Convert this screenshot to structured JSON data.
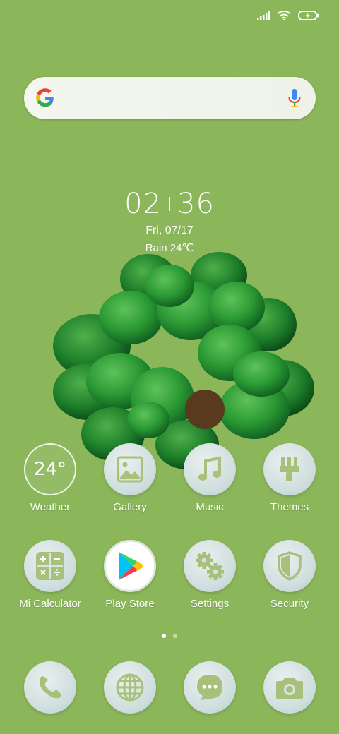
{
  "status_bar": {
    "signal_icon": "signal-icon",
    "wifi_icon": "wifi-icon",
    "battery_icon": "battery-charging-icon"
  },
  "search": {
    "logo_icon": "google-g-icon",
    "mic_icon": "mic-icon"
  },
  "clock": {
    "hours": "02",
    "minutes": "36",
    "date": "Fri, 07/17",
    "weather": "Rain 24℃"
  },
  "apps_row1": [
    {
      "label": "Weather",
      "value": "24°",
      "icon": "weather-icon"
    },
    {
      "label": "Gallery",
      "icon": "gallery-icon"
    },
    {
      "label": "Music",
      "icon": "music-icon"
    },
    {
      "label": "Themes",
      "icon": "brush-icon"
    }
  ],
  "apps_row2": [
    {
      "label": "Mi Calculator",
      "icon": "calculator-icon"
    },
    {
      "label": "Play Store",
      "icon": "play-store-icon"
    },
    {
      "label": "Settings",
      "icon": "gears-icon"
    },
    {
      "label": "Security",
      "icon": "shield-icon"
    }
  ],
  "dock": [
    {
      "name": "phone",
      "icon": "phone-icon"
    },
    {
      "name": "browser",
      "icon": "globe-icon"
    },
    {
      "name": "messages",
      "icon": "message-icon"
    },
    {
      "name": "camera",
      "icon": "camera-icon"
    }
  ],
  "pager": {
    "pages": 2,
    "active": 1
  },
  "colors": {
    "wallpaper": "#8bb65a",
    "icon_glyph": "#a7c07a"
  }
}
